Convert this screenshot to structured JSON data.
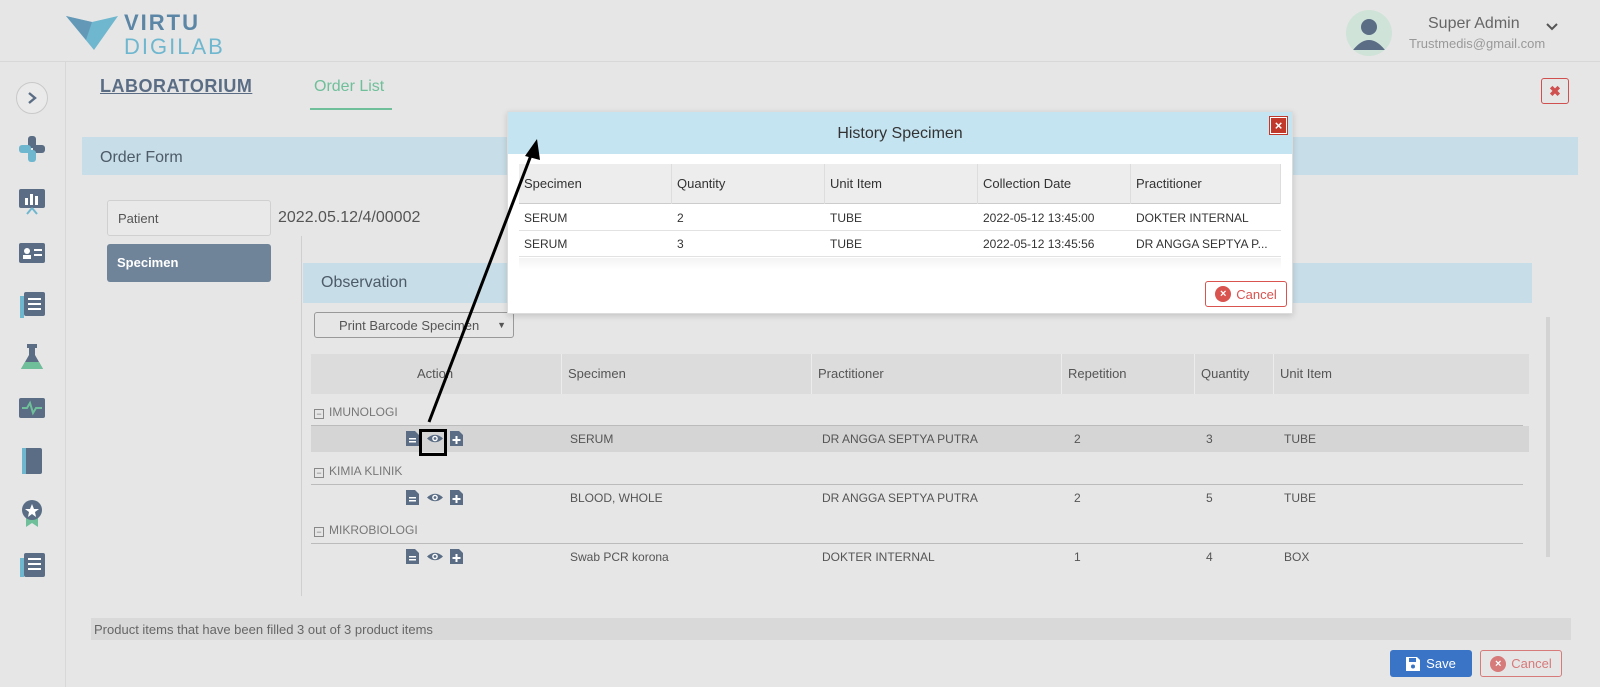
{
  "brand": {
    "line1": "VIRTU",
    "line2": "DIGILAB",
    "colors": {
      "primary": "#5c86a6",
      "accent": "#6fb7cf"
    }
  },
  "user": {
    "name": "Super Admin",
    "email": "Trustmedis@gmail.com"
  },
  "sidebar": {
    "toggle_icon": "chevron-right-icon",
    "icons": [
      "plus-cross-icon",
      "chart-board-icon",
      "id-card-icon",
      "document-stack-icon",
      "flask-icon",
      "monitor-pulse-icon",
      "book-icon",
      "award-icon",
      "newspaper-icon"
    ]
  },
  "tabs": {
    "laboratorium": "LABORATORIUM",
    "order_list": "Order List"
  },
  "order_form": {
    "title": "Order Form",
    "side_nav": [
      "Patient",
      "Specimen"
    ],
    "patient_value": "2022.05.12/4/00002"
  },
  "observation": {
    "title": "Observation",
    "print_button": "Print Barcode Specimen",
    "columns": [
      "Action",
      "Specimen",
      "Practitioner",
      "Repetition",
      "Quantity",
      "Unit Item"
    ],
    "groups": [
      {
        "name": "IMUNOLOGI",
        "row": {
          "specimen": "SERUM",
          "practitioner": "DR ANGGA SEPTYA PUTRA",
          "repetition": "2",
          "quantity": "3",
          "unit": "TUBE"
        }
      },
      {
        "name": "KIMIA KLINIK",
        "row": {
          "specimen": "BLOOD, WHOLE",
          "practitioner": "DR ANGGA SEPTYA PUTRA",
          "repetition": "2",
          "quantity": "5",
          "unit": "TUBE"
        }
      },
      {
        "name": "MIKROBIOLOGI",
        "row": {
          "specimen": "Swab PCR korona",
          "practitioner": "DOKTER INTERNAL",
          "repetition": "1",
          "quantity": "4",
          "unit": "BOX"
        }
      }
    ]
  },
  "footer": {
    "status": "Product items that have been filled 3 out of 3 product items",
    "save": "Save",
    "cancel": "Cancel"
  },
  "modal": {
    "title": "History Specimen",
    "columns": [
      "Specimen",
      "Quantity",
      "Unit Item",
      "Collection Date",
      "Practitioner"
    ],
    "rows": [
      {
        "specimen": "SERUM",
        "quantity": "2",
        "unit": "TUBE",
        "date": "2022-05-12 13:45:00",
        "practitioner": "DOKTER INTERNAL"
      },
      {
        "specimen": "SERUM",
        "quantity": "3",
        "unit": "TUBE",
        "date": "2022-05-12 13:45:56",
        "practitioner": "DR ANGGA SEPTYA P..."
      }
    ],
    "cancel": "Cancel"
  }
}
